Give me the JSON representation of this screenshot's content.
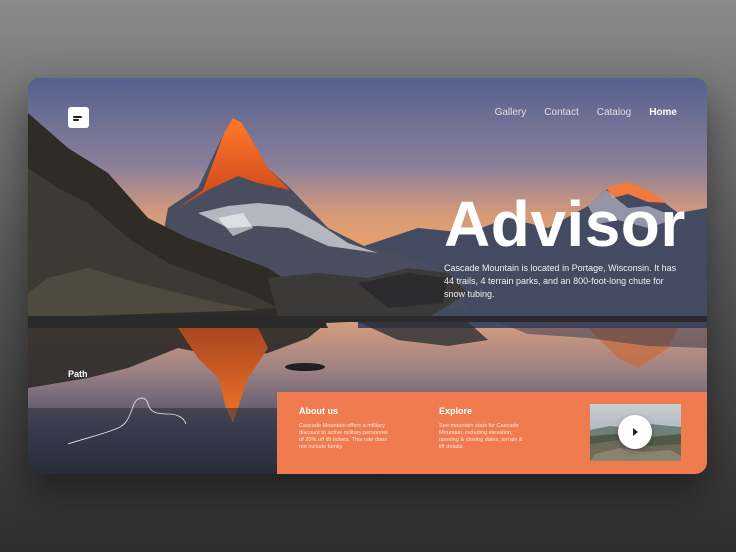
{
  "header": {
    "menu_icon": "menu-icon",
    "nav": [
      {
        "label": "Gallery"
      },
      {
        "label": "Contact"
      },
      {
        "label": "Catalog"
      },
      {
        "label": "Home",
        "active": true
      }
    ]
  },
  "hero": {
    "title": "Advisor",
    "description": "Cascade Mountain is located in Portage, Wisconsin. It has 44 trails, 4 terrain parks, and an 800-foot-long chute for snow tubing."
  },
  "path": {
    "label": "Path"
  },
  "info": {
    "about": {
      "heading": "About us",
      "text": "Cascade Mountain offers a military discount to active military personnel of 20% off lift tickets. This rate does not include family"
    },
    "explore": {
      "heading": "Explore",
      "text": "See mountain stats for Cascade Mountain, including elevation, opening & closing dates, terrain & lift details."
    },
    "video": {
      "play_icon": "play-icon"
    }
  },
  "colors": {
    "accent": "#f07b4f",
    "peak_glow": "#f26a1f",
    "sky_top": "#5a6896",
    "sky_horizon": "#e8a06a"
  }
}
